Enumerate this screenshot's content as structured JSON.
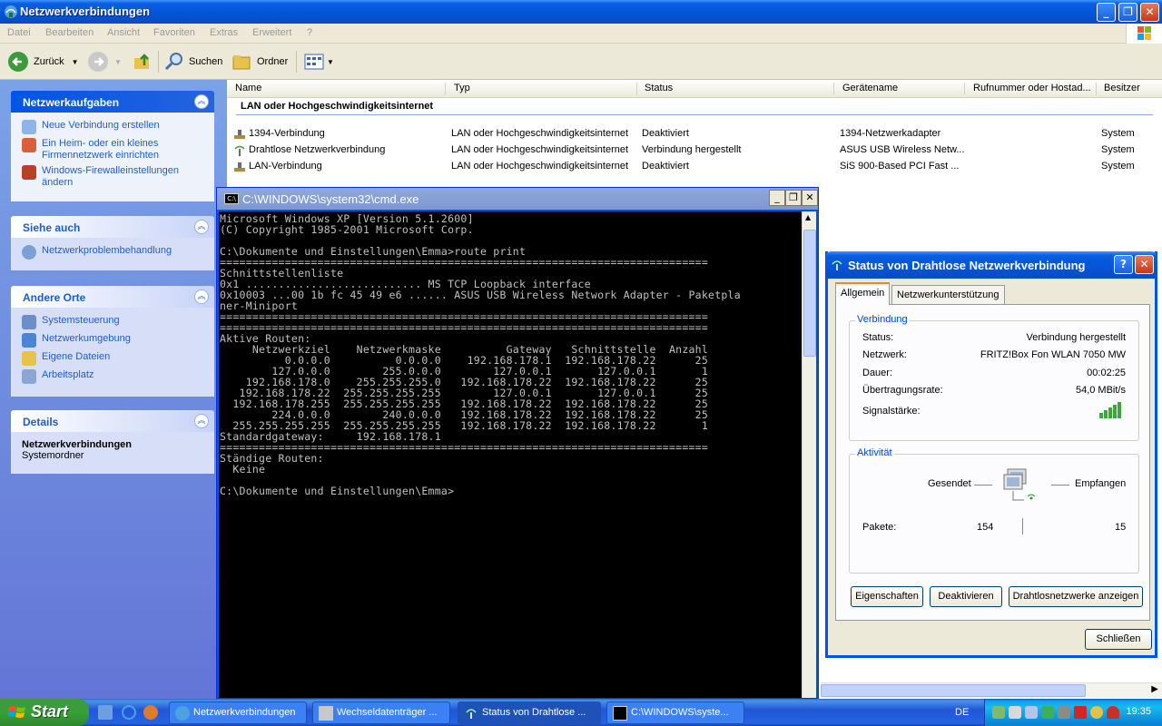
{
  "main_window": {
    "title": "Netzwerkverbindungen",
    "menu": [
      "Datei",
      "Bearbeiten",
      "Ansicht",
      "Favoriten",
      "Extras",
      "Erweitert",
      "?"
    ],
    "toolbar": {
      "back": "Zurück",
      "search": "Suchen",
      "folders": "Ordner"
    }
  },
  "taskpane": {
    "network_tasks": {
      "title": "Netzwerkaufgaben",
      "items": [
        "Neue Verbindung erstellen",
        "Ein Heim- oder ein kleines Firmennetzwerk einrichten",
        "Windows-Firewalleinstellungen ändern"
      ]
    },
    "see_also": {
      "title": "Siehe auch",
      "items": [
        "Netzwerkproblembehandlung"
      ]
    },
    "other_places": {
      "title": "Andere Orte",
      "items": [
        "Systemsteuerung",
        "Netzwerkumgebung",
        "Eigene Dateien",
        "Arbeitsplatz"
      ]
    },
    "details": {
      "title": "Details",
      "name": "Netzwerkverbindungen",
      "type": "Systemordner"
    }
  },
  "listview": {
    "columns": [
      "Name",
      "Typ",
      "Status",
      "Gerätename",
      "Rufnummer oder Hostad...",
      "Besitzer"
    ],
    "group": "LAN oder Hochgeschwindigkeitsinternet",
    "rows": [
      {
        "name": "1394-Verbindung",
        "type": "LAN oder Hochgeschwindigkeitsinternet",
        "status": "Deaktiviert",
        "device": "1394-Netzwerkadapter",
        "owner": "System"
      },
      {
        "name": "Drahtlose Netzwerkverbindung",
        "type": "LAN oder Hochgeschwindigkeitsinternet",
        "status": "Verbindung hergestellt",
        "device": "ASUS USB Wireless Netw...",
        "owner": "System"
      },
      {
        "name": "LAN-Verbindung",
        "type": "LAN oder Hochgeschwindigkeitsinternet",
        "status": "Deaktiviert",
        "device": "SiS 900-Based PCI Fast ...",
        "owner": "System"
      }
    ]
  },
  "cmd": {
    "title": "C:\\WINDOWS\\system32\\cmd.exe",
    "output": "Microsoft Windows XP [Version 5.1.2600]\n(C) Copyright 1985-2001 Microsoft Corp.\n\nC:\\Dokumente und Einstellungen\\Emma>route print\n===========================================================================\nSchnittstellenliste\n0x1 ........................... MS TCP Loopback interface\n0x10003 ...00 1b fc 45 49 e6 ...... ASUS USB Wireless Network Adapter - Paketpla\nner-Miniport\n===========================================================================\n===========================================================================\nAktive Routen:\n     Netzwerkziel    Netzwerkmaske          Gateway   Schnittstelle  Anzahl\n          0.0.0.0          0.0.0.0    192.168.178.1  192.168.178.22      25\n        127.0.0.0        255.0.0.0        127.0.0.1       127.0.0.1       1\n    192.168.178.0    255.255.255.0   192.168.178.22  192.168.178.22      25\n   192.168.178.22  255.255.255.255        127.0.0.1       127.0.0.1      25\n  192.168.178.255  255.255.255.255   192.168.178.22  192.168.178.22      25\n        224.0.0.0        240.0.0.0   192.168.178.22  192.168.178.22      25\n  255.255.255.255  255.255.255.255   192.168.178.22  192.168.178.22       1\nStandardgateway:     192.168.178.1\n===========================================================================\nStändige Routen:\n  Keine\n\nC:\\Dokumente und Einstellungen\\Emma>"
  },
  "status_dialog": {
    "title": "Status von Drahtlose Netzwerkverbindung",
    "tabs": [
      "Allgemein",
      "Netzwerkunterstützung"
    ],
    "connection": {
      "label": "Verbindung",
      "status_label": "Status:",
      "status": "Verbindung hergestellt",
      "network_label": "Netzwerk:",
      "network": "FRITZ!Box Fon WLAN 7050 MW",
      "duration_label": "Dauer:",
      "duration": "00:02:25",
      "speed_label": "Übertragungsrate:",
      "speed": "54,0 MBit/s",
      "signal_label": "Signalstärke:",
      "signal_bars": 5
    },
    "activity": {
      "label": "Aktivität",
      "sent_label": "Gesendet",
      "received_label": "Empfangen",
      "packets_label": "Pakete:",
      "sent": "154",
      "received": "15"
    },
    "buttons": {
      "properties": "Eigenschaften",
      "disable": "Deaktivieren",
      "wireless": "Drahtlosnetzwerke anzeigen",
      "close": "Schließen"
    }
  },
  "taskbar": {
    "start": "Start",
    "tasks": [
      "Netzwerkverbindungen",
      "Wechseldatenträger ...",
      "Status von Drahtlose ...",
      "C:\\WINDOWS\\syste..."
    ],
    "language": "DE",
    "clock": "19:35"
  }
}
